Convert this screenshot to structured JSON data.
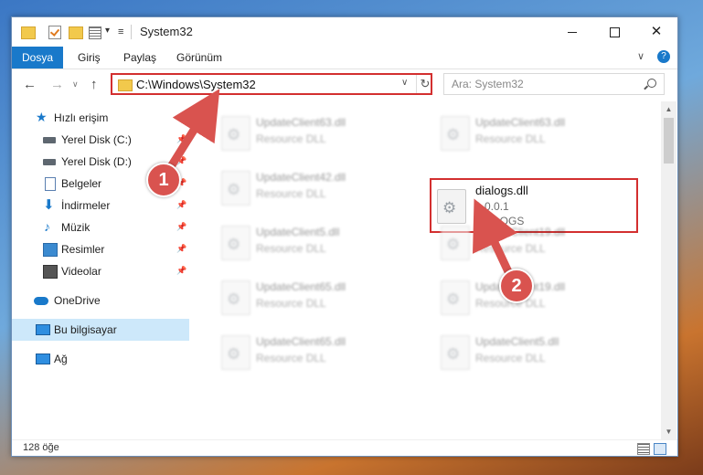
{
  "window": {
    "title": "System32",
    "quick_access": [
      "folder-icon",
      "properties-check-icon",
      "new-folder-icon",
      "view-props-icon"
    ]
  },
  "ribbon": {
    "tabs": [
      "Dosya",
      "Giriş",
      "Paylaş",
      "Görünüm"
    ],
    "help_label": "?"
  },
  "nav": {
    "address": "C:\\Windows\\System32",
    "search_placeholder": "Ara: System32"
  },
  "sidebar": {
    "items": [
      {
        "label": "Hızlı erişim",
        "icon": "star-icon",
        "pinned": false
      },
      {
        "label": "Yerel Disk (C:)",
        "icon": "disk-icon",
        "pinned": true
      },
      {
        "label": "Yerel Disk (D:)",
        "icon": "disk-icon",
        "pinned": true
      },
      {
        "label": "Belgeler",
        "icon": "document-icon",
        "pinned": true
      },
      {
        "label": "İndirmeler",
        "icon": "download-icon",
        "pinned": true
      },
      {
        "label": "Müzik",
        "icon": "music-icon",
        "pinned": true
      },
      {
        "label": "Resimler",
        "icon": "pictures-icon",
        "pinned": true
      },
      {
        "label": "Videolar",
        "icon": "video-icon",
        "pinned": true
      },
      {
        "label": "OneDrive",
        "icon": "cloud-icon",
        "pinned": false
      },
      {
        "label": "Bu bilgisayar",
        "icon": "computer-icon",
        "pinned": false,
        "selected": true
      },
      {
        "label": "Ağ",
        "icon": "network-icon",
        "pinned": false
      }
    ]
  },
  "files": {
    "left": [
      {
        "name": "UpdateClient63.dll",
        "type": "Resource DLL"
      },
      {
        "name": "UpdateClient42.dll",
        "type": "Resource DLL"
      },
      {
        "name": "UpdateClient5.dll",
        "type": "Resource DLL"
      },
      {
        "name": "UpdateClient65.dll",
        "type": "Resource DLL"
      },
      {
        "name": "UpdateClient65.dll",
        "type": "Resource DLL"
      }
    ],
    "right": [
      {
        "name": "UpdateClient63.dll",
        "type": "Resource DLL"
      },
      {
        "name": "dialogs.dll",
        "version": "1.0.0.1",
        "type": "DIALOGS",
        "highlighted": true
      },
      {
        "name": "UpdateClient19.dll",
        "type": "Resource DLL"
      },
      {
        "name": "UpdateClient19.dll",
        "type": "Resource DLL"
      },
      {
        "name": "UpdateClient5.dll",
        "type": "Resource DLL"
      }
    ]
  },
  "status": {
    "item_count": "128 öğe"
  },
  "annotations": {
    "step1": "1",
    "step2": "2",
    "color": "#d9534f"
  },
  "colors": {
    "accent": "#1979ca",
    "highlight_border": "#d32f2f",
    "selected_bg": "#cde8fa"
  }
}
